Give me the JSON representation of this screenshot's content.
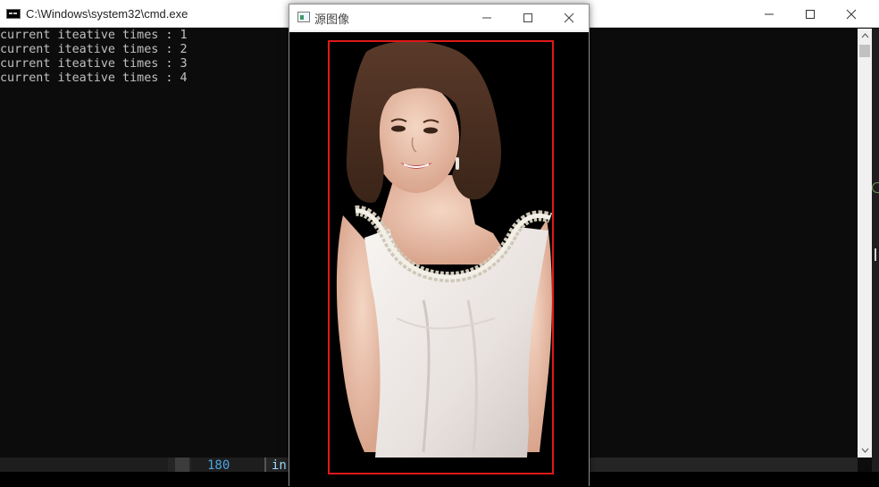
{
  "console": {
    "title": "C:\\Windows\\system32\\cmd.exe",
    "lines": [
      "current iteative times : 1",
      "current iteative times : 2",
      "current iteative times : 3",
      "current iteative times : 4"
    ]
  },
  "image_window": {
    "title": "源图像",
    "roi_color": "#e01818"
  },
  "editor": {
    "line_number": "180",
    "code": "in"
  },
  "colors": {
    "console_bg": "#0c0c0c",
    "console_text": "#c0c0c0",
    "line_number": "#4aa3df"
  }
}
